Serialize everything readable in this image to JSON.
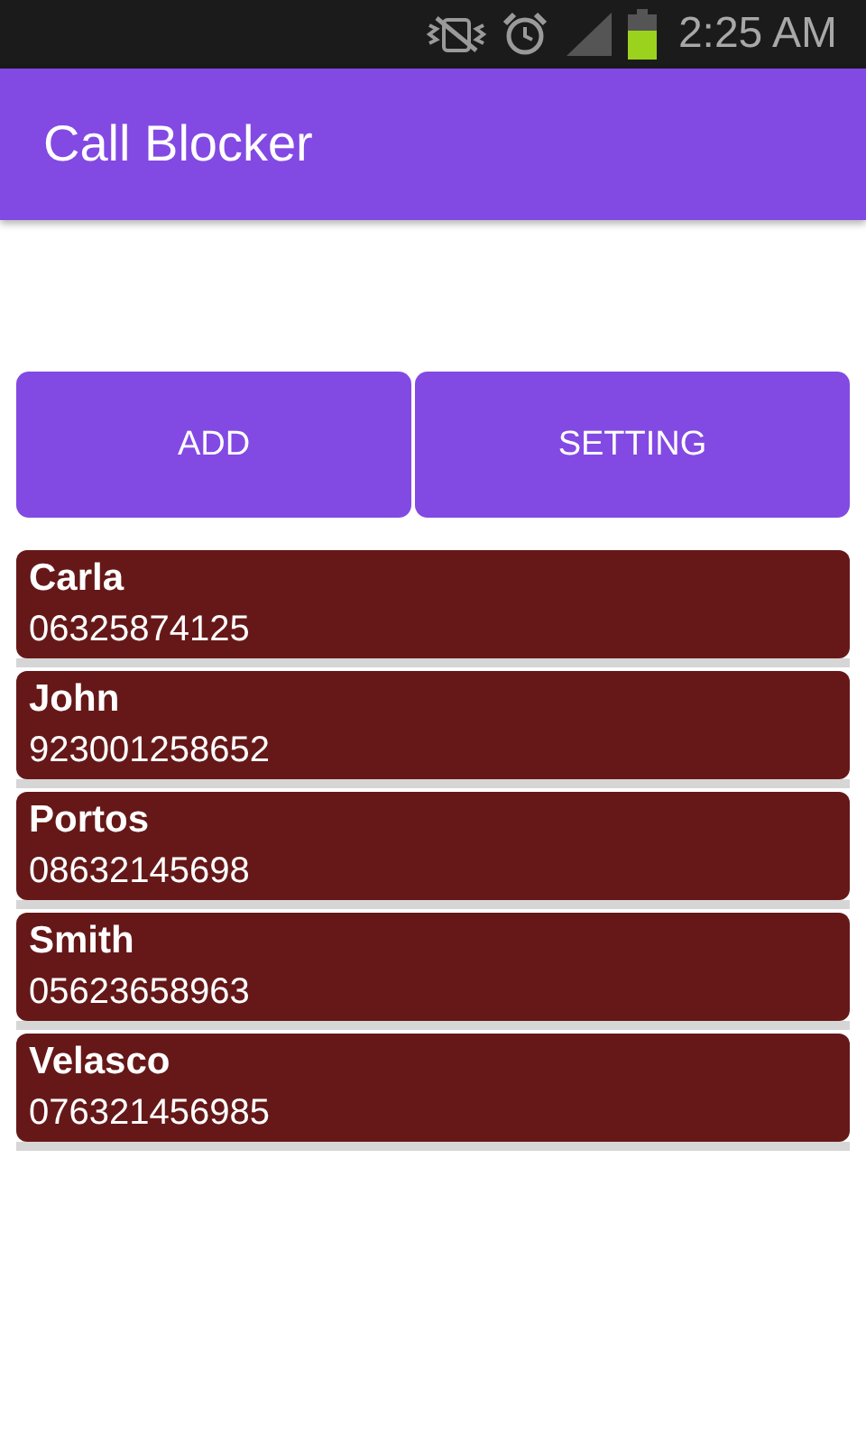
{
  "status_bar": {
    "time": "2:25 AM"
  },
  "app_bar": {
    "title": "Call Blocker"
  },
  "buttons": [
    "ADD",
    "SETTING"
  ],
  "contacts": [
    {
      "name": "Carla",
      "number": "06325874125"
    },
    {
      "name": "John",
      "number": "923001258652"
    },
    {
      "name": "Portos",
      "number": "08632145698"
    },
    {
      "name": "Smith",
      "number": "05623658963"
    },
    {
      "name": "Velasco",
      "number": "076321456985"
    }
  ]
}
